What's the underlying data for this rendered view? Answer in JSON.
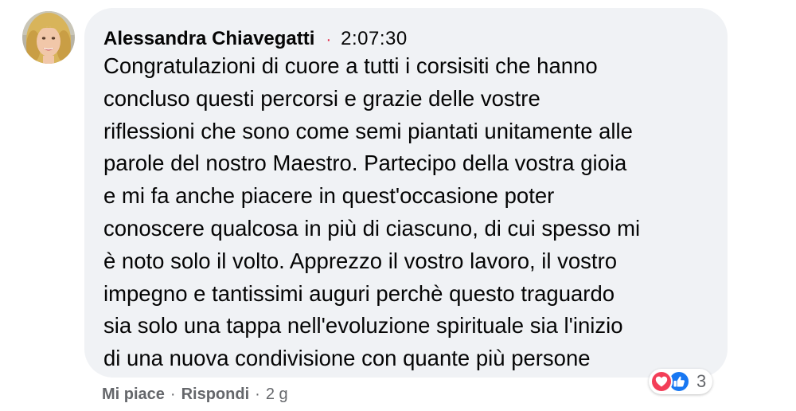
{
  "comment": {
    "author": "Alessandra Chiavegatti",
    "separator": "·",
    "time": "2:07:30",
    "text": "Congratulazioni di cuore a tutti i corsisiti che hanno\nconcluso questi percorsi e grazie delle vostre\nriflessioni che sono come semi piantati unitamente alle\nparole del nostro Maestro. Partecipo della vostra gioia\ne mi fa anche piacere in quest'occasione poter\nconoscere qualcosa in più di ciascuno, di cui spesso mi\nè noto solo il volto. Apprezzo il vostro lavoro, il vostro\nimpegno e tantissimi auguri perchè questo traguardo\nsia solo una tappa nell'evoluzione spirituale sia l'inizio\ndi una nuova condivisione con quante più persone"
  },
  "reactions": {
    "icons": [
      "love-icon",
      "like-icon"
    ],
    "count": "3",
    "colors": {
      "love": "#f33e58",
      "like": "#1877f2"
    }
  },
  "actions": {
    "like_label": "Mi piace",
    "reply_label": "Rispondi",
    "separator": "·",
    "age": "2 g"
  },
  "colors": {
    "bubble": "#f0f2f5",
    "text": "#050505",
    "secondary": "#65676b",
    "online_dot": "#e41e3f"
  }
}
